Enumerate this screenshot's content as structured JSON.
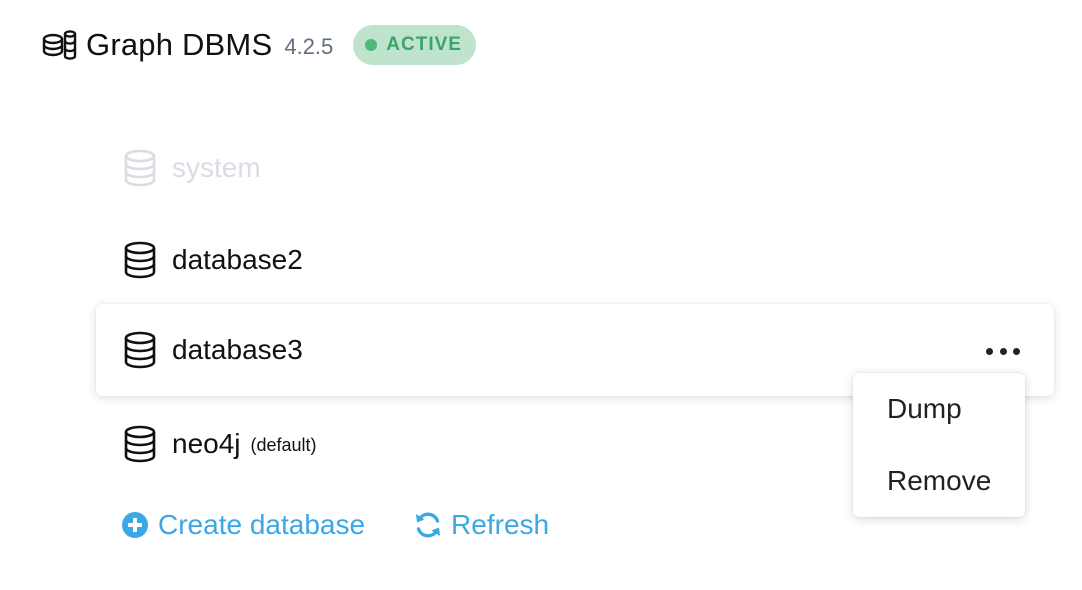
{
  "header": {
    "icon": "databases-icon",
    "title": "Graph DBMS",
    "version": "4.2.5",
    "status": "ACTIVE",
    "status_color": "#3ba468",
    "status_bg": "#bfe3cd"
  },
  "databases": [
    {
      "name": "system",
      "tag": "",
      "disabled": true
    },
    {
      "name": "database2",
      "tag": ""
    },
    {
      "name": "database3",
      "tag": "",
      "highlighted": true
    },
    {
      "name": "neo4j",
      "tag": "(default)"
    }
  ],
  "context_menu": {
    "items": [
      "Dump",
      "Remove"
    ]
  },
  "actions": {
    "create_label": "Create database",
    "create_icon": "plus-circle-icon",
    "refresh_label": "Refresh",
    "refresh_icon": "refresh-icon",
    "accent_color": "#3aa7e6"
  }
}
